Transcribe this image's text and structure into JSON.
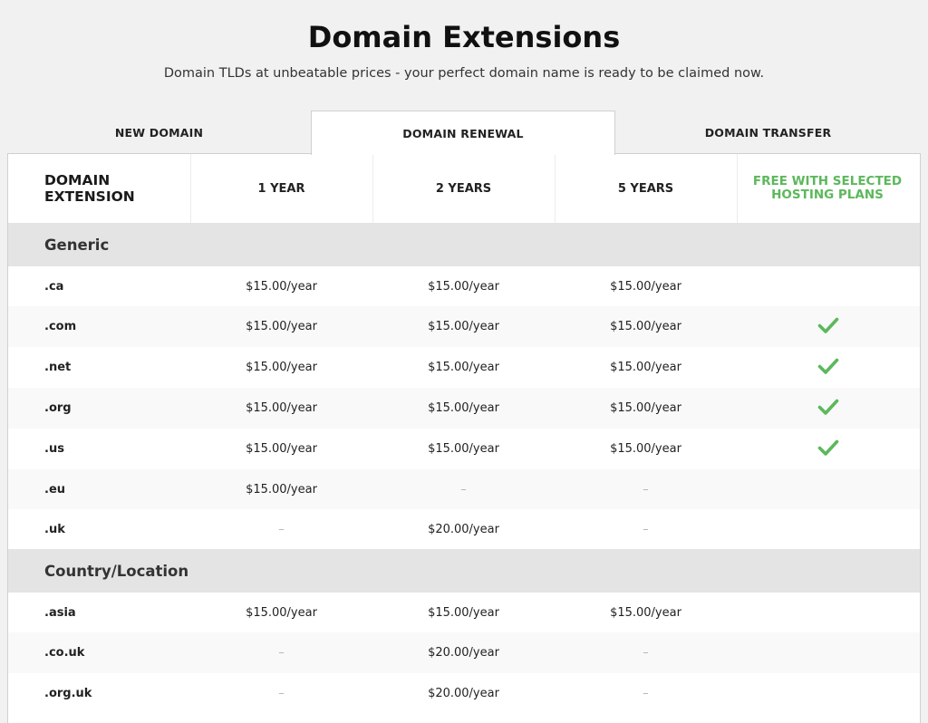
{
  "header": {
    "title": "Domain Extensions",
    "subtitle": "Domain TLDs at unbeatable prices - your perfect domain name is ready to be claimed now."
  },
  "tabs": [
    {
      "label": "NEW DOMAIN",
      "active": false
    },
    {
      "label": "DOMAIN RENEWAL",
      "active": true
    },
    {
      "label": "DOMAIN TRANSFER",
      "active": false
    }
  ],
  "table": {
    "columns": {
      "extension": "DOMAIN EXTENSION",
      "year1": "1 YEAR",
      "year2": "2 YEARS",
      "year5": "5 YEARS",
      "free": "FREE WITH SELECTED HOSTING PLANS"
    },
    "groups": [
      {
        "name": "Generic",
        "rows": [
          {
            "ext": ".ca",
            "y1": "$15.00/year",
            "y2": "$15.00/year",
            "y5": "$15.00/year",
            "free": false
          },
          {
            "ext": ".com",
            "y1": "$15.00/year",
            "y2": "$15.00/year",
            "y5": "$15.00/year",
            "free": true
          },
          {
            "ext": ".net",
            "y1": "$15.00/year",
            "y2": "$15.00/year",
            "y5": "$15.00/year",
            "free": true
          },
          {
            "ext": ".org",
            "y1": "$15.00/year",
            "y2": "$15.00/year",
            "y5": "$15.00/year",
            "free": true
          },
          {
            "ext": ".us",
            "y1": "$15.00/year",
            "y2": "$15.00/year",
            "y5": "$15.00/year",
            "free": true
          },
          {
            "ext": ".eu",
            "y1": "$15.00/year",
            "y2": "–",
            "y5": "–",
            "free": false
          },
          {
            "ext": ".uk",
            "y1": "–",
            "y2": "$20.00/year",
            "y5": "–",
            "free": false
          }
        ]
      },
      {
        "name": "Country/Location",
        "rows": [
          {
            "ext": ".asia",
            "y1": "$15.00/year",
            "y2": "$15.00/year",
            "y5": "$15.00/year",
            "free": false
          },
          {
            "ext": ".co.uk",
            "y1": "–",
            "y2": "$20.00/year",
            "y5": "–",
            "free": false
          },
          {
            "ext": ".org.uk",
            "y1": "–",
            "y2": "$20.00/year",
            "y5": "–",
            "free": false
          }
        ]
      }
    ]
  },
  "colors": {
    "accent_green": "#5cb85c",
    "group_bg": "#e4e4e4",
    "page_bg": "#f1f1f1"
  },
  "icons": {
    "free_indicator": "checkmark-icon"
  }
}
